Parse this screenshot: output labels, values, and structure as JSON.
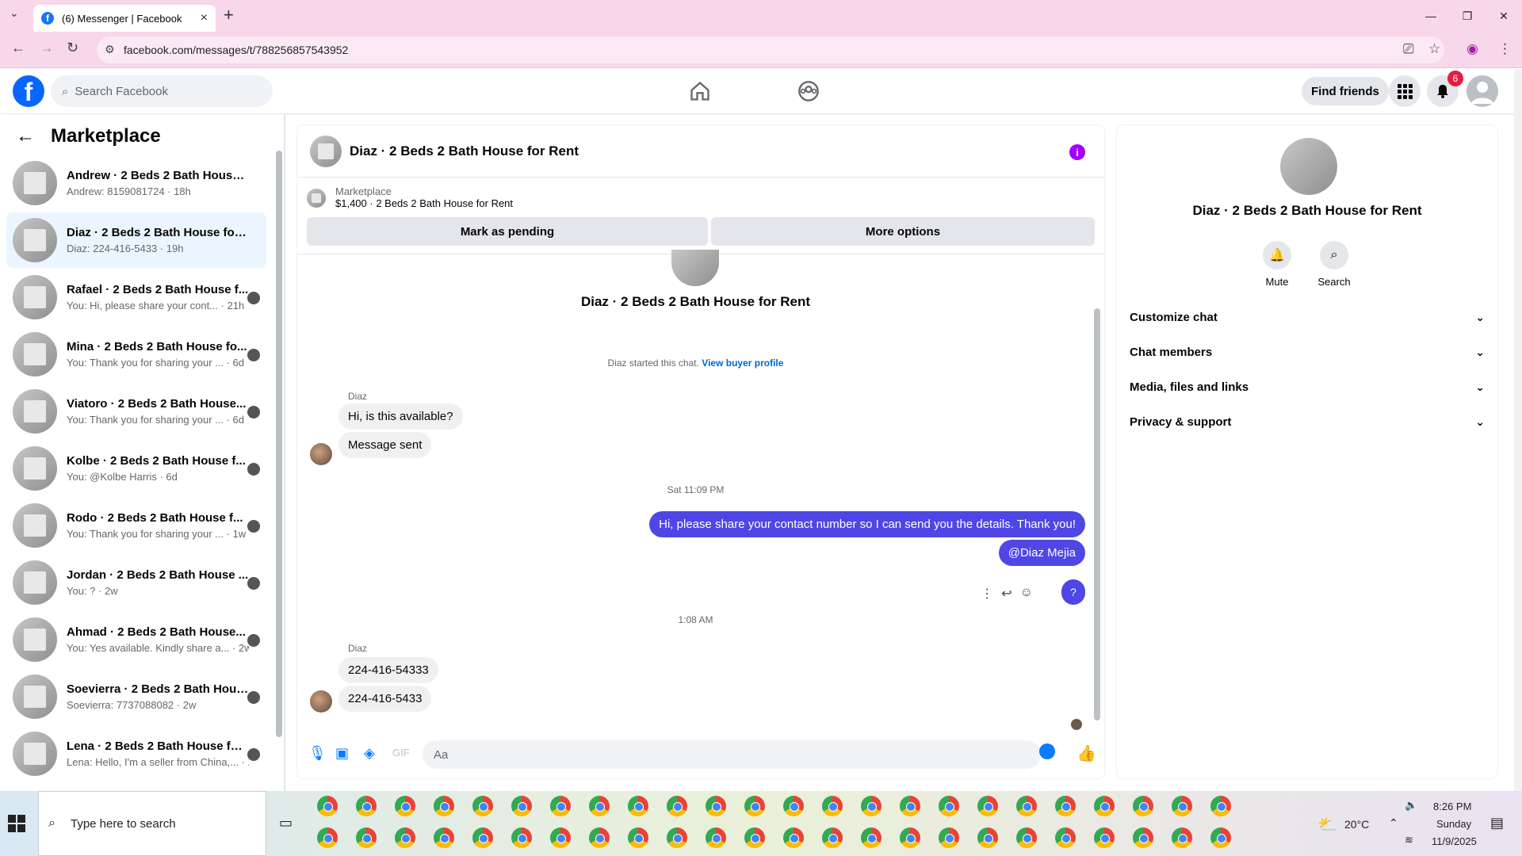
{
  "browser": {
    "tab_title": "(6) Messenger | Facebook",
    "url": "facebook.com/messages/t/788256857543952"
  },
  "header": {
    "search_placeholder": "Search Facebook",
    "find_friends": "Find friends",
    "notification_count": "6"
  },
  "sidebar": {
    "title": "Marketplace",
    "conversations": [
      {
        "name": "Andrew · 2 Beds 2 Bath House f...",
        "sub": "Andrew: 8159081724 · 18h"
      },
      {
        "name": "Diaz · 2 Beds 2 Bath House for R...",
        "sub": "Diaz: 224-416-5433 · 19h"
      },
      {
        "name": "Rafael · 2 Beds 2 Bath House f...",
        "sub": "You: Hi, please share your cont... · 21h"
      },
      {
        "name": "Mina · 2 Beds 2 Bath House fo...",
        "sub": "You: Thank you for sharing your ... · 6d"
      },
      {
        "name": "Viatoro · 2 Beds 2 Bath House...",
        "sub": "You: Thank you for sharing your ... · 6d"
      },
      {
        "name": "Kolbe · 2 Beds 2 Bath House f...",
        "sub": "You: @Kolbe Harris · 6d"
      },
      {
        "name": "Rodo · 2 Beds 2 Bath House f...",
        "sub": "You: Thank you for sharing your ... · 1w"
      },
      {
        "name": "Jordan · 2 Beds 2 Bath House ...",
        "sub": "You: ? · 2w"
      },
      {
        "name": "Ahmad · 2 Beds 2 Bath House...",
        "sub": "You: Yes available. Kindly share a... · 2w"
      },
      {
        "name": "Soevierra · 2 Beds 2 Bath House ...",
        "sub": "Soevierra: 7737088082 · 2w"
      },
      {
        "name": "Lena · 2 Beds 2 Bath House for R...",
        "sub": "Lena: Hello, I'm a seller from China,... · 2w"
      }
    ]
  },
  "chat": {
    "title": "Diaz · 2 Beds 2 Bath House for Rent",
    "marketplace_label": "Marketplace",
    "listing": "$1,400 · 2 Beds 2 Bath House for Rent",
    "mark_pending": "Mark as pending",
    "more_options": "More options",
    "intro_name": "Diaz · 2 Beds 2 Bath House for Rent",
    "started_text": "Diaz started this chat.",
    "view_buyer": "View buyer profile",
    "sender1": "Diaz",
    "msg1": "Hi, is this available?",
    "msg2": "Message sent",
    "ts1": "Sat 11:09 PM",
    "out1": "Hi, please share your contact number so I can send you the details. Thank you!",
    "out2": "@Diaz Mejia",
    "out3": "?",
    "ts2": "1:08 AM",
    "sender2": "Diaz",
    "msg3": "224-416-54333",
    "msg4": "224-416-5433",
    "composer_placeholder": "Aa"
  },
  "right_panel": {
    "name": "Diaz · 2 Beds 2 Bath House for Rent",
    "mute": "Mute",
    "search": "Search",
    "rows": [
      "Customize chat",
      "Chat members",
      "Media, files and links",
      "Privacy & support"
    ]
  },
  "taskbar": {
    "search_placeholder": "Type here to search",
    "temp": "20°C",
    "time": "8:26 PM",
    "day": "Sunday",
    "date": "11/9/2025"
  }
}
